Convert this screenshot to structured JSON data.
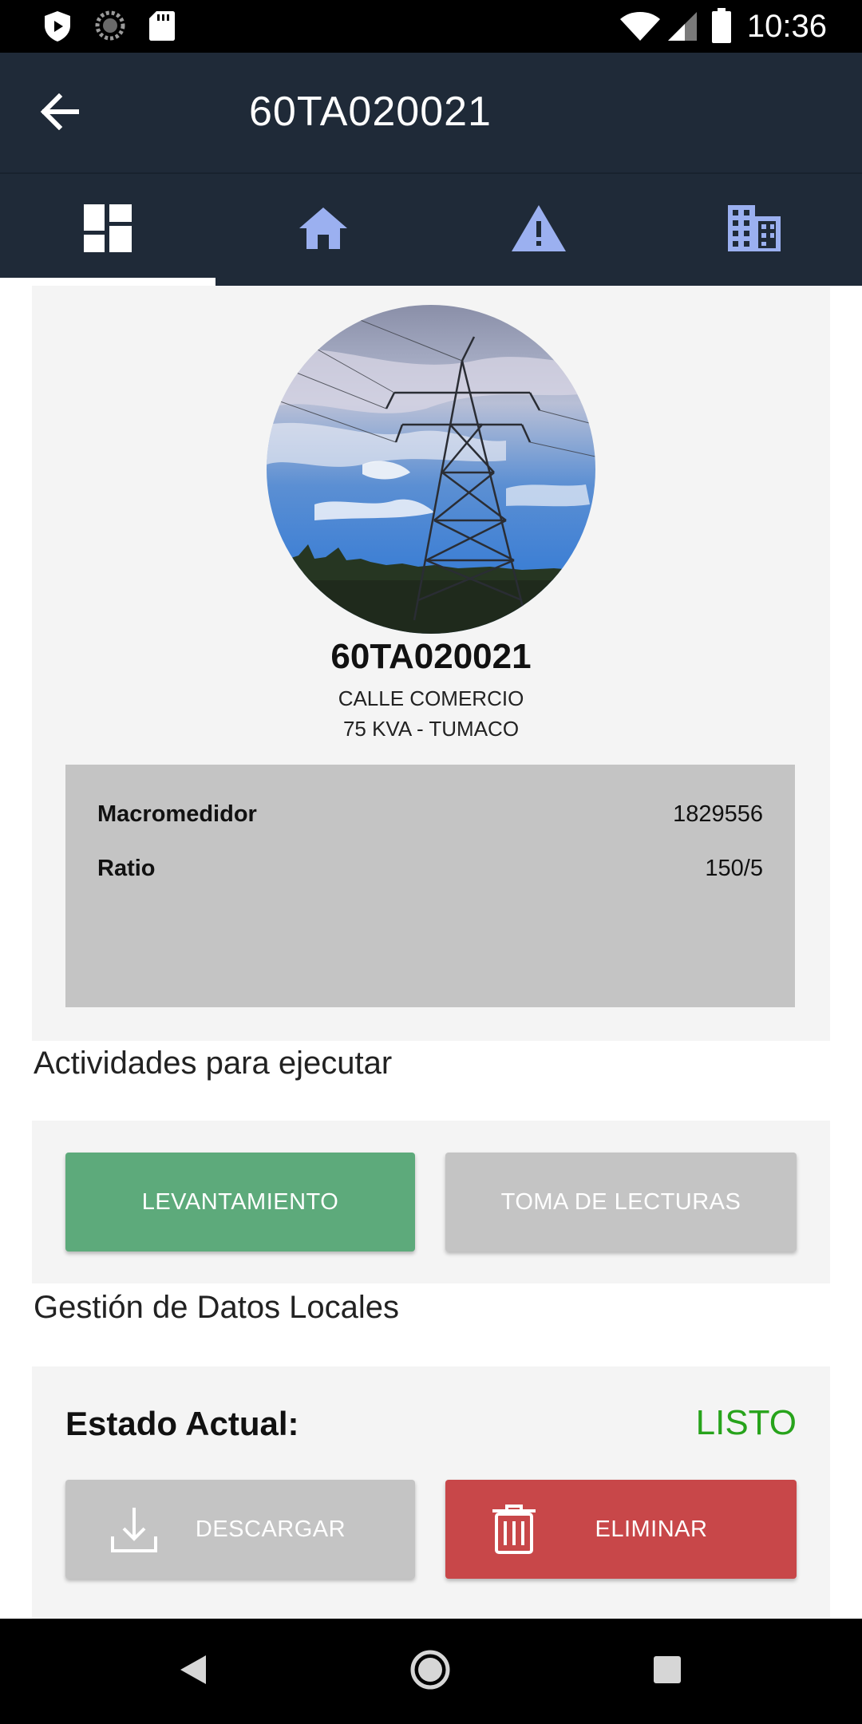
{
  "status_bar": {
    "time": "10:36",
    "icons": [
      "play-protect-icon",
      "loading-icon",
      "sd-card-icon",
      "wifi-icon",
      "signal-icon",
      "battery-icon"
    ]
  },
  "app_bar": {
    "title": "60TA020021",
    "back_icon": "arrow-back-icon"
  },
  "tabs": [
    {
      "icon": "dashboard-icon",
      "selected": true
    },
    {
      "icon": "home-icon",
      "selected": false
    },
    {
      "icon": "warning-icon",
      "selected": false
    },
    {
      "icon": "building-icon",
      "selected": false
    }
  ],
  "profile": {
    "image": "transmission-tower-photo",
    "name": "60TA020021",
    "line1": "CALLE COMERCIO",
    "line2": "75 KVA - TUMACO",
    "details": [
      {
        "label": "Macromedidor",
        "value": "1829556"
      },
      {
        "label": "Ratio",
        "value": "150/5"
      }
    ]
  },
  "activities": {
    "title": "Actividades para ejecutar",
    "buttons": [
      {
        "label": "LEVANTAMIENTO",
        "color": "#5daa7b"
      },
      {
        "label": "TOMA DE LECTURAS",
        "color": "#c4c4c4"
      }
    ]
  },
  "local_data": {
    "title": "Gestión de Datos Locales",
    "status_label": "Estado Actual:",
    "status_value": "LISTO",
    "status_color": "#27a31b",
    "buttons": [
      {
        "label": "DESCARGAR",
        "icon": "download-icon",
        "color": "#c4c4c4"
      },
      {
        "label": "ELIMINAR",
        "icon": "trash-icon",
        "color": "#c84749"
      }
    ]
  },
  "colors": {
    "app_bar": "#1f2a38",
    "tab_icon": "#9bb0f0",
    "card_bg": "#f4f4f4"
  },
  "nav_bar": {
    "icons": [
      "nav-back-icon",
      "nav-home-icon",
      "nav-recents-icon"
    ]
  }
}
